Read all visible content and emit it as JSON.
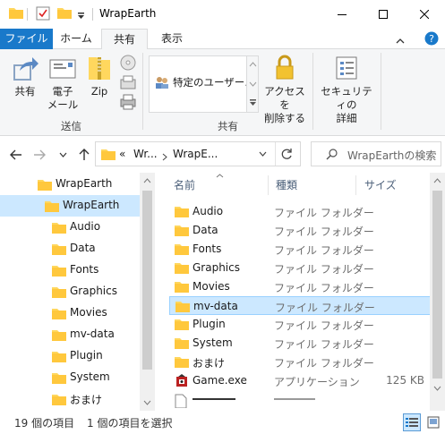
{
  "window": {
    "title": "WrapEarth",
    "minimize_icon": "minimize-icon",
    "maximize_icon": "maximize-icon",
    "close_icon": "close-icon"
  },
  "ribbon_tabs": [
    "ファイル",
    "ホーム",
    "共有",
    "表示"
  ],
  "ribbon": {
    "send_group": {
      "label": "送信",
      "share_label": "共有",
      "email_label_1": "電子",
      "email_label_2": "メール",
      "zip_label": "Zip"
    },
    "share_group": {
      "label": "共有",
      "share_target": "特定のユーザー…",
      "access_label_1": "アクセスを",
      "access_label_2": "削除する",
      "security_label_1": "セキュリティの",
      "security_label_2": "詳細"
    }
  },
  "address": {
    "overflow": "«",
    "crumbs": [
      "Wr...",
      "WrapE..."
    ],
    "search_placeholder": "WrapEarthの検索"
  },
  "tree": {
    "items": [
      {
        "label": "WrapEarth",
        "level": 0,
        "selected": false
      },
      {
        "label": "WrapEarth",
        "level": 1,
        "selected": true
      },
      {
        "label": "Audio",
        "level": 2,
        "selected": false
      },
      {
        "label": "Data",
        "level": 2,
        "selected": false
      },
      {
        "label": "Fonts",
        "level": 2,
        "selected": false
      },
      {
        "label": "Graphics",
        "level": 2,
        "selected": false
      },
      {
        "label": "Movies",
        "level": 2,
        "selected": false
      },
      {
        "label": "mv-data",
        "level": 2,
        "selected": false
      },
      {
        "label": "Plugin",
        "level": 2,
        "selected": false
      },
      {
        "label": "System",
        "level": 2,
        "selected": false
      },
      {
        "label": "おまけ",
        "level": 2,
        "selected": false
      }
    ]
  },
  "file_list": {
    "columns": {
      "name": "名前",
      "type": "種類",
      "size": "サイズ"
    },
    "rows": [
      {
        "name": "Audio",
        "type": "ファイル フォルダー",
        "size": "",
        "kind": "folder",
        "selected": false
      },
      {
        "name": "Data",
        "type": "ファイル フォルダー",
        "size": "",
        "kind": "folder",
        "selected": false
      },
      {
        "name": "Fonts",
        "type": "ファイル フォルダー",
        "size": "",
        "kind": "folder",
        "selected": false
      },
      {
        "name": "Graphics",
        "type": "ファイル フォルダー",
        "size": "",
        "kind": "folder",
        "selected": false
      },
      {
        "name": "Movies",
        "type": "ファイル フォルダー",
        "size": "",
        "kind": "folder",
        "selected": false
      },
      {
        "name": "mv-data",
        "type": "ファイル フォルダー",
        "size": "",
        "kind": "folder",
        "selected": true
      },
      {
        "name": "Plugin",
        "type": "ファイル フォルダー",
        "size": "",
        "kind": "folder",
        "selected": false
      },
      {
        "name": "System",
        "type": "ファイル フォルダー",
        "size": "",
        "kind": "folder",
        "selected": false
      },
      {
        "name": "おまけ",
        "type": "ファイル フォルダー",
        "size": "",
        "kind": "folder",
        "selected": false
      },
      {
        "name": "Game.exe",
        "type": "アプリケーション",
        "size": "125 KB",
        "kind": "exe",
        "selected": false
      }
    ]
  },
  "status_bar": {
    "item_count": "19 個の項目",
    "selection": "1 個の項目を選択"
  },
  "colors": {
    "accent": "#1979ca",
    "selection": "#cce8ff",
    "folder": "#ffd75e"
  }
}
